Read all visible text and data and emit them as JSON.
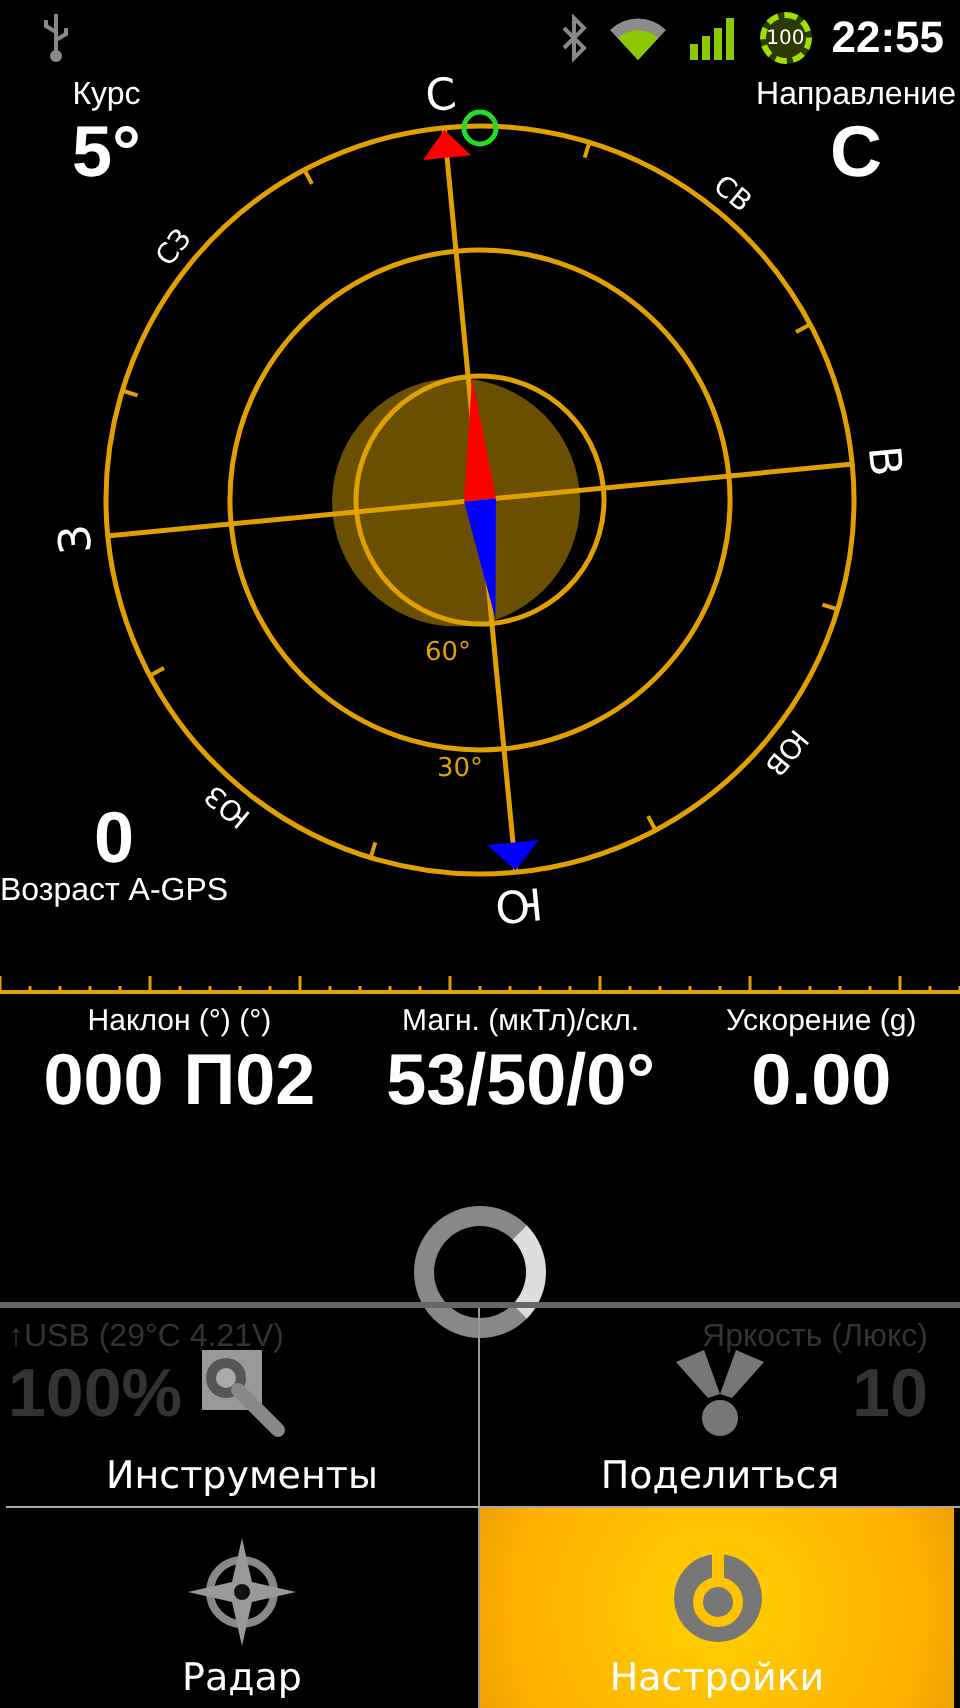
{
  "status_bar": {
    "battery": "100",
    "time": "22:55"
  },
  "heading": {
    "label": "Курс",
    "value": "5°"
  },
  "direction": {
    "label": "Направление",
    "value": "С"
  },
  "agps": {
    "value": "0",
    "label": "Возраст A-GPS"
  },
  "compass": {
    "directions": [
      "С",
      "СВ",
      "В",
      "ЮВ",
      "Ю",
      "ЮЗ",
      "З",
      "СЗ"
    ],
    "elevation_labels": [
      "60°",
      "30°"
    ]
  },
  "stats": [
    {
      "label": "Наклон (°) (°)",
      "value": "000 П02"
    },
    {
      "label": "Магн. (мкТл)/скл.",
      "value": "53/50/0°"
    },
    {
      "label": "Ускорение (g)",
      "value": "0.00"
    }
  ],
  "sensors": [
    {
      "label": "↑USB (29°C 4.21V)",
      "value": "100%"
    },
    {
      "label": "Яркость (Люкс)",
      "value": "10"
    }
  ],
  "menu": [
    {
      "label": "Инструменты",
      "selected": false
    },
    {
      "label": "Поделиться",
      "selected": false
    },
    {
      "label": "Радар",
      "selected": false
    },
    {
      "label": "Настройки",
      "selected": true
    }
  ]
}
